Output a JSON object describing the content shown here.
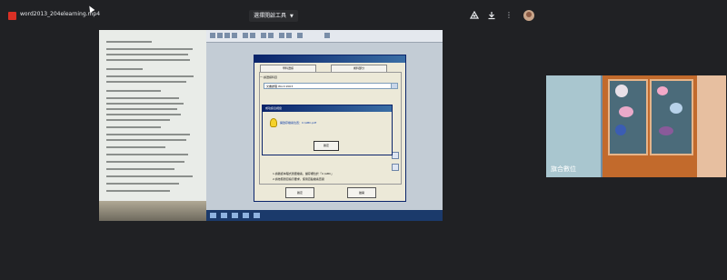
{
  "topbar": {
    "file_name": "word2013_204elearning.mp4",
    "open_with_label": "選擇開啟工具",
    "icons": [
      "file-video-icon",
      "add-to-drive-icon",
      "download-icon",
      "more-vert-icon",
      "avatar"
    ]
  },
  "video": {
    "dialog": {
      "tab1": "學科選擇",
      "tab2": "術科部分",
      "group_label": "一.請選擇科目",
      "selected_subject": "文書處理 Word 2003",
      "hint1": "1.請確認本程式題庫檔案，儲存槽位於「C:\\ABC」",
      "hint2": "2.請依照題目指示要求，使用百點檔案查閱",
      "confirm_button": "確定",
      "cancel_button": "離開"
    },
    "message_box": {
      "title": "成功訊息視窗",
      "text": "開啟存檔案位置：C:\\ABC.pdf",
      "ok_button": "確定"
    }
  },
  "participant": {
    "name": "旗合數位"
  },
  "colors": {
    "background": "#202124",
    "accent_red": "#d93025"
  }
}
